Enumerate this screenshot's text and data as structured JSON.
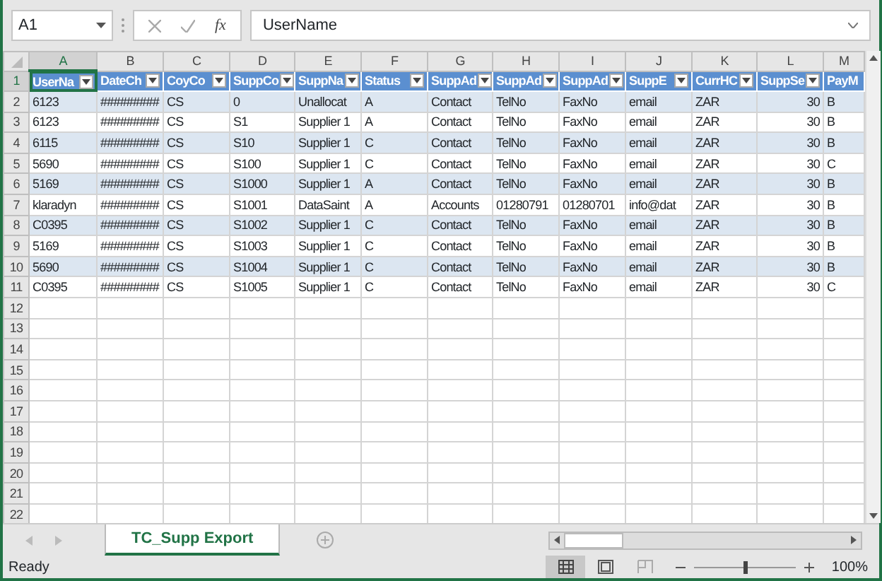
{
  "formula_bar": {
    "name_box": "A1",
    "function_label": "fx",
    "value": "UserName"
  },
  "columns": [
    {
      "letter": "A",
      "selected": true
    },
    {
      "letter": "B",
      "selected": false
    },
    {
      "letter": "C",
      "selected": false
    },
    {
      "letter": "D",
      "selected": false
    },
    {
      "letter": "E",
      "selected": false
    },
    {
      "letter": "F",
      "selected": false
    },
    {
      "letter": "G",
      "selected": false
    },
    {
      "letter": "H",
      "selected": false
    },
    {
      "letter": "I",
      "selected": false
    },
    {
      "letter": "J",
      "selected": false
    },
    {
      "letter": "K",
      "selected": false
    },
    {
      "letter": "L",
      "selected": false
    },
    {
      "letter": "M",
      "selected": false
    }
  ],
  "row_numbers": [
    {
      "label": "1",
      "selected": true
    },
    {
      "label": "2",
      "selected": false
    },
    {
      "label": "3",
      "selected": false
    },
    {
      "label": "4",
      "selected": false
    },
    {
      "label": "5",
      "selected": false
    },
    {
      "label": "6",
      "selected": false
    },
    {
      "label": "7",
      "selected": false
    },
    {
      "label": "8",
      "selected": false
    },
    {
      "label": "9",
      "selected": false
    },
    {
      "label": "10",
      "selected": false
    },
    {
      "label": "11",
      "selected": false
    },
    {
      "label": "12",
      "selected": false
    },
    {
      "label": "13",
      "selected": false
    },
    {
      "label": "14",
      "selected": false
    },
    {
      "label": "15",
      "selected": false
    },
    {
      "label": "16",
      "selected": false
    },
    {
      "label": "17",
      "selected": false
    },
    {
      "label": "18",
      "selected": false
    },
    {
      "label": "19",
      "selected": false
    },
    {
      "label": "20",
      "selected": false
    },
    {
      "label": "21",
      "selected": false
    },
    {
      "label": "22",
      "selected": false
    }
  ],
  "table": {
    "columns": [
      {
        "header": "UserNa",
        "kind": "text",
        "filter": true
      },
      {
        "header": "DateCh",
        "kind": "text",
        "filter": true
      },
      {
        "header": "CoyCo",
        "kind": "text",
        "filter": true
      },
      {
        "header": "SuppCo",
        "kind": "text",
        "filter": true
      },
      {
        "header": "SuppNa",
        "kind": "text",
        "filter": true
      },
      {
        "header": "Status",
        "kind": "text",
        "filter": true
      },
      {
        "header": "SuppAd",
        "kind": "text",
        "filter": true
      },
      {
        "header": "SuppAd",
        "kind": "text",
        "filter": true
      },
      {
        "header": "SuppAd",
        "kind": "text",
        "filter": true
      },
      {
        "header": "SuppE",
        "kind": "text",
        "filter": true
      },
      {
        "header": "CurrHC",
        "kind": "text",
        "filter": true
      },
      {
        "header": "SuppSe",
        "kind": "number",
        "filter": true
      },
      {
        "header": "PayM",
        "kind": "text",
        "filter": false
      }
    ],
    "rows": [
      [
        "6123",
        "#########",
        "CS",
        "0",
        "Unallocat",
        "A",
        "Contact",
        "TelNo",
        "FaxNo",
        "email",
        "ZAR",
        "30",
        "B"
      ],
      [
        "6123",
        "#########",
        "CS",
        "S1",
        "Supplier 1",
        "A",
        "Contact",
        "TelNo",
        "FaxNo",
        "email",
        "ZAR",
        "30",
        "B"
      ],
      [
        "6115",
        "#########",
        "CS",
        "S10",
        "Supplier 1",
        "C",
        "Contact",
        "TelNo",
        "FaxNo",
        "email",
        "ZAR",
        "30",
        "B"
      ],
      [
        "5690",
        "#########",
        "CS",
        "S100",
        "Supplier 1",
        "C",
        "Contact",
        "TelNo",
        "FaxNo",
        "email",
        "ZAR",
        "30",
        "C"
      ],
      [
        "5169",
        "#########",
        "CS",
        "S1000",
        "Supplier 1",
        "A",
        "Contact",
        "TelNo",
        "FaxNo",
        "email",
        "ZAR",
        "30",
        "B"
      ],
      [
        "klaradyn",
        "#########",
        "CS",
        "S1001",
        "DataSaint",
        "A",
        "Accounts",
        "01280791",
        "01280701",
        "info@dat",
        "ZAR",
        "30",
        "B"
      ],
      [
        "C0395",
        "#########",
        "CS",
        "S1002",
        "Supplier 1",
        "C",
        "Contact",
        "TelNo",
        "FaxNo",
        "email",
        "ZAR",
        "30",
        "B"
      ],
      [
        "5169",
        "#########",
        "CS",
        "S1003",
        "Supplier 1",
        "C",
        "Contact",
        "TelNo",
        "FaxNo",
        "email",
        "ZAR",
        "30",
        "B"
      ],
      [
        "5690",
        "#########",
        "CS",
        "S1004",
        "Supplier 1",
        "C",
        "Contact",
        "TelNo",
        "FaxNo",
        "email",
        "ZAR",
        "30",
        "B"
      ],
      [
        "C0395",
        "#########",
        "CS",
        "S1005",
        "Supplier 1",
        "C",
        "Contact",
        "TelNo",
        "FaxNo",
        "email",
        "ZAR",
        "30",
        "C"
      ]
    ]
  },
  "sheet_tabs": [
    {
      "label": "TC_Supp Export",
      "selected": true
    }
  ],
  "status_bar": {
    "text": "Ready",
    "views": [
      {
        "kind": "normal",
        "selected": true
      },
      {
        "kind": "page_layout",
        "selected": false
      },
      {
        "kind": "page_break",
        "selected": false
      }
    ],
    "zoom": {
      "level": 0.5,
      "label": "100%"
    }
  }
}
